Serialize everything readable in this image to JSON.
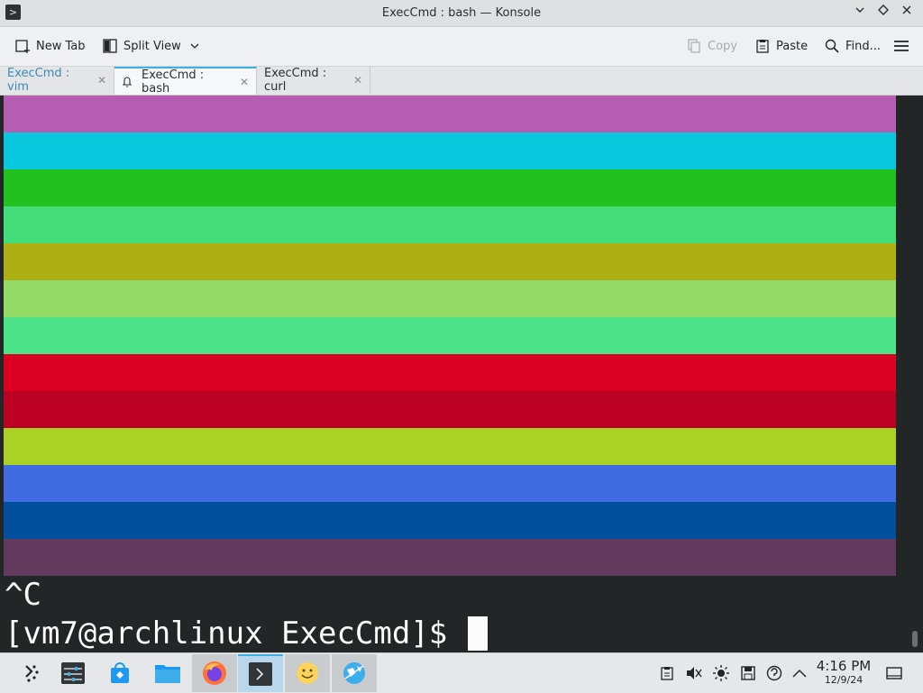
{
  "window": {
    "title": "ExecCmd : bash — Konsole",
    "app_icon": "terminal-icon"
  },
  "toolbar": {
    "new_tab": "New Tab",
    "split_view": "Split View",
    "copy": "Copy",
    "paste": "Paste",
    "find": "Find...",
    "menu_icon": "hamburger-menu-icon"
  },
  "tabs": [
    {
      "label": "ExecCmd : vim",
      "active": false
    },
    {
      "label": "ExecCmd : bash",
      "active": true
    },
    {
      "label": "ExecCmd : curl",
      "active": false
    }
  ],
  "terminal": {
    "stripe_colors": [
      "#b55db1",
      "#09c8dd",
      "#23c11f",
      "#44dc79",
      "#acb015",
      "#93db66",
      "#4de38a",
      "#d90021",
      "#bb0023",
      "#aad226",
      "#416ce1",
      "#014f9d",
      "#613a5d"
    ],
    "line1": "^C",
    "prompt": "[vm7@archlinux ExecCmd]$ "
  },
  "taskbar": {
    "apps": [
      "application-launcher-icon",
      "system-settings-icon",
      "discover-store-icon",
      "file-manager-icon",
      "firefox-icon",
      "konsole-icon",
      "emoji-app-icon",
      "network-globe-icon"
    ],
    "clock_time": "4:16 PM",
    "clock_date": "12/9/24"
  }
}
